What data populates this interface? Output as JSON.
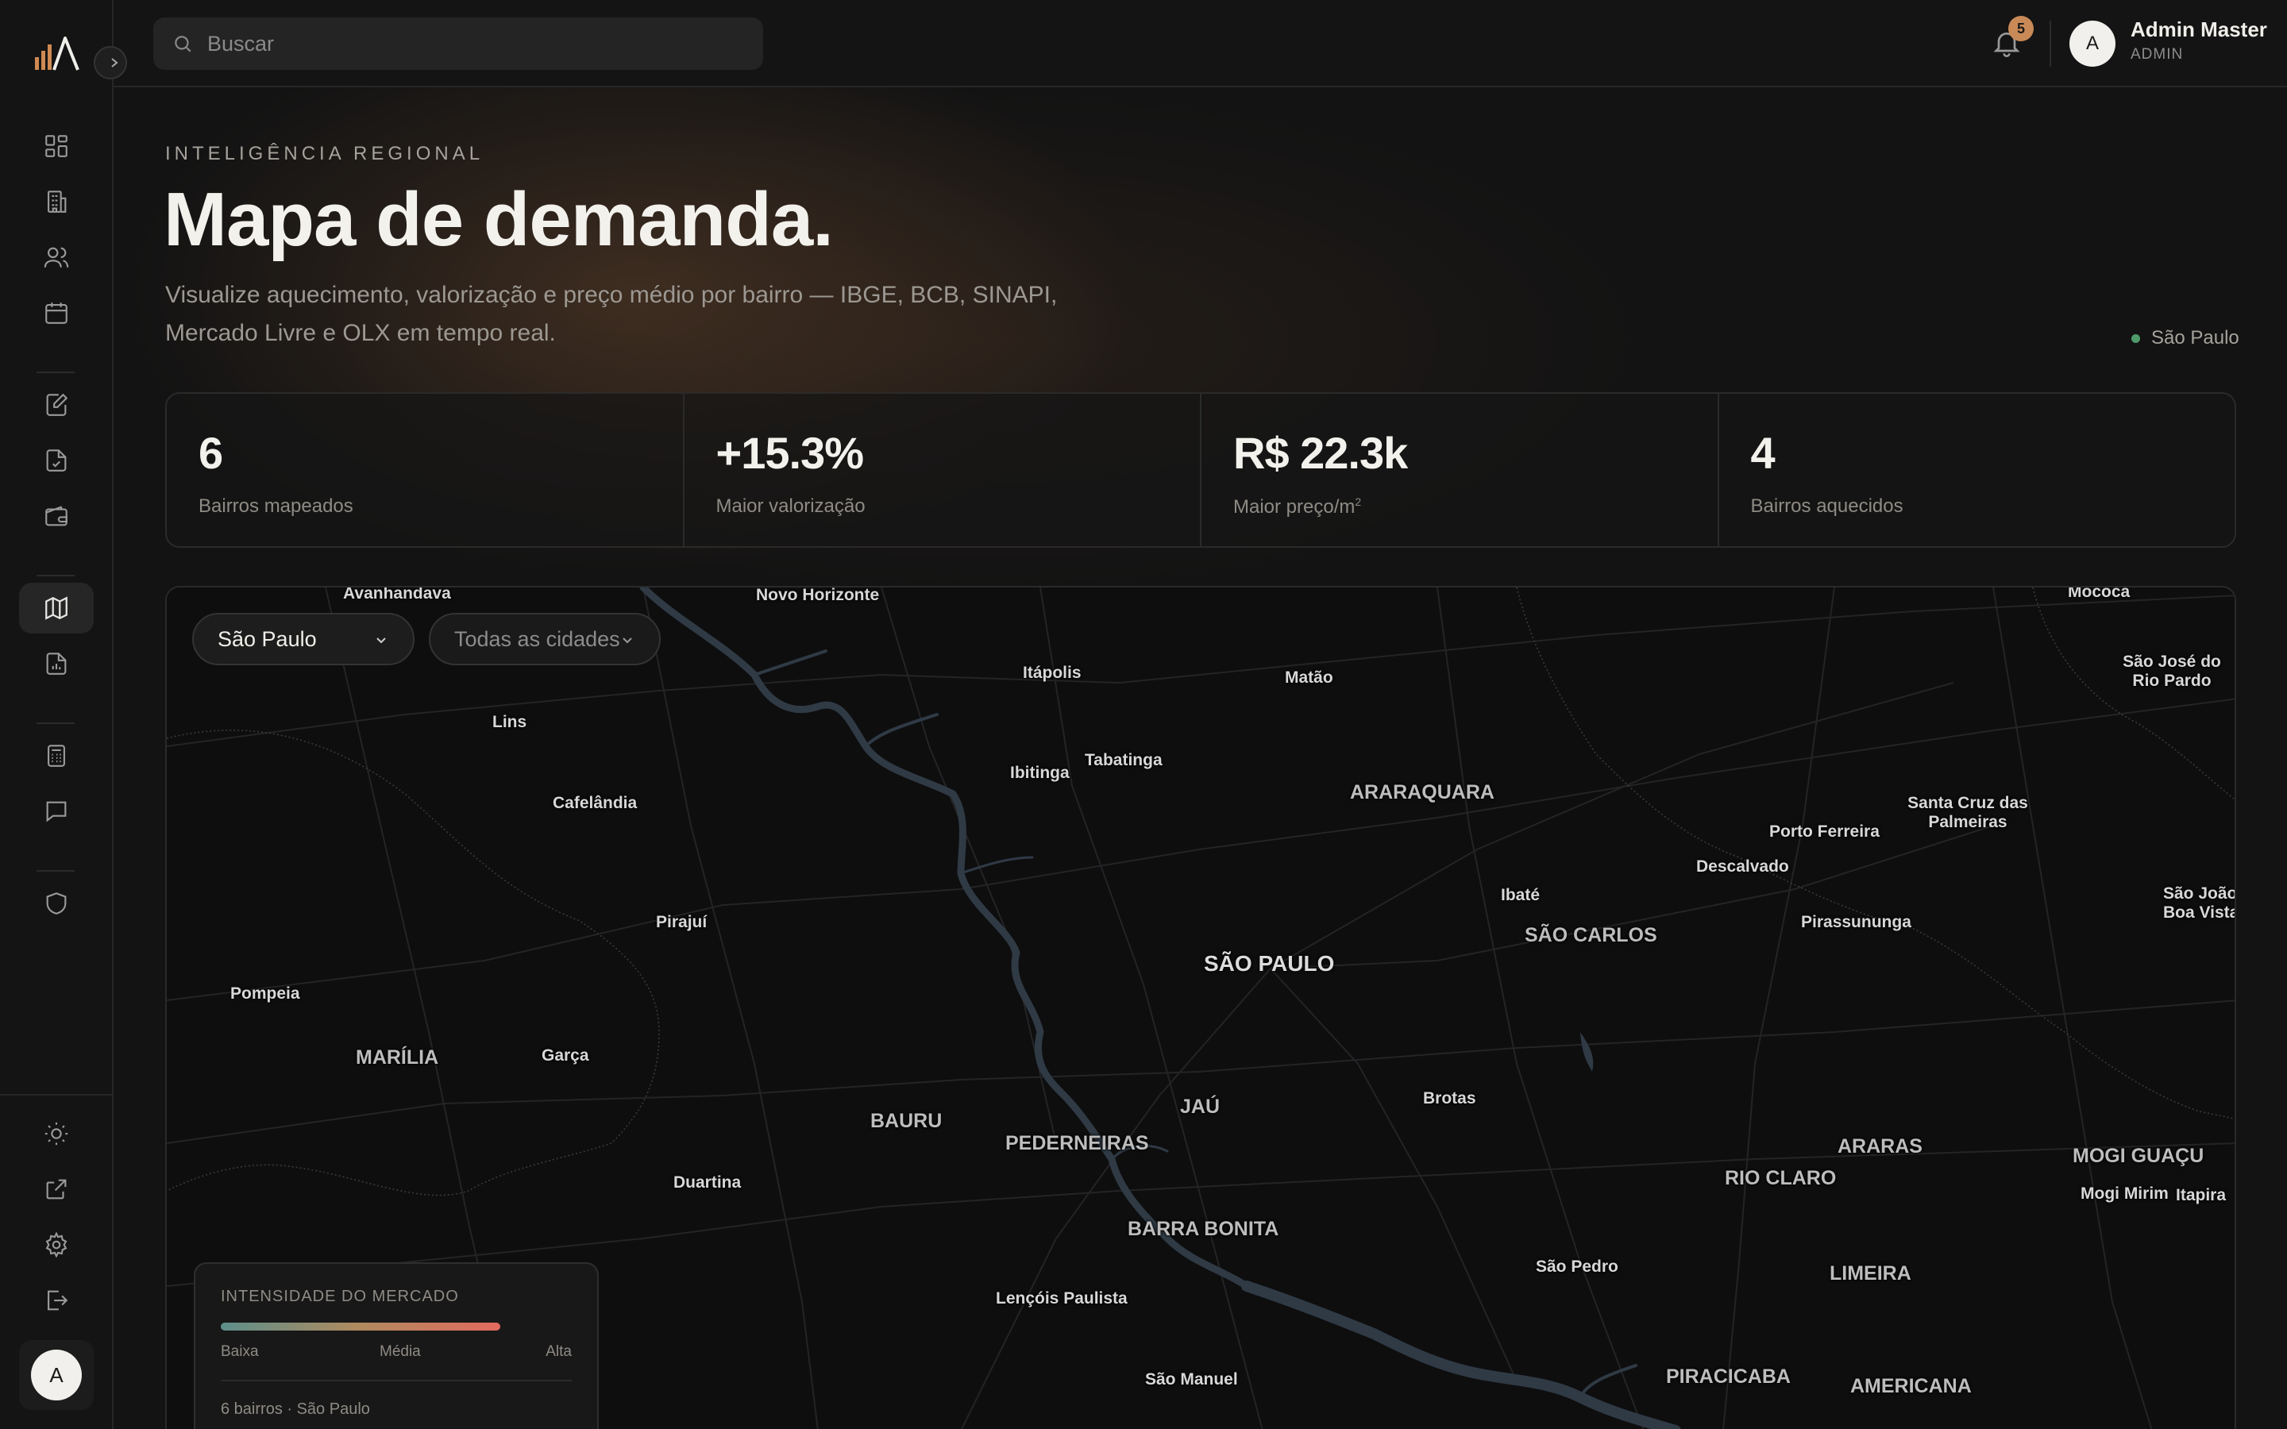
{
  "topbar": {
    "search_placeholder": "Buscar",
    "notifications_count": "5",
    "user": {
      "initial": "A",
      "name": "Admin Master",
      "role": "ADMIN"
    }
  },
  "sidebar": {
    "avatar_initial": "A",
    "items": [
      {
        "icon": "dashboard-icon"
      },
      {
        "icon": "building-icon"
      },
      {
        "icon": "users-icon"
      },
      {
        "icon": "calendar-icon"
      },
      {
        "icon": "edit-document-icon"
      },
      {
        "icon": "document-check-icon"
      },
      {
        "icon": "wallet-icon"
      },
      {
        "icon": "map-icon",
        "active": true
      },
      {
        "icon": "report-icon"
      },
      {
        "icon": "calculator-icon"
      },
      {
        "icon": "chat-icon"
      },
      {
        "icon": "shield-icon"
      },
      {
        "icon": "sun-icon"
      },
      {
        "icon": "external-link-icon"
      },
      {
        "icon": "settings-icon"
      },
      {
        "icon": "logout-icon"
      }
    ]
  },
  "hero": {
    "eyebrow": "INTELIGÊNCIA REGIONAL",
    "title": "Mapa de demanda.",
    "subtitle": "Visualize aquecimento, valorização e preço médio por bairro — IBGE, BCB, SINAPI, Mercado Livre e OLX em tempo real.",
    "region": "São Paulo",
    "region_dot_color": "#4f9a6b"
  },
  "stats": [
    {
      "value": "6",
      "label": "Bairros mapeados"
    },
    {
      "value": "+15.3%",
      "label": "Maior valorização"
    },
    {
      "value": "R$ 22.3k",
      "label": "Maior preço/m",
      "sup": "2"
    },
    {
      "value": "4",
      "label": "Bairros aquecidos"
    }
  ],
  "map": {
    "state_select": "São Paulo",
    "city_select": "Todas as cidades",
    "cities": [
      {
        "name": "Avanhandava",
        "kind": "small"
      },
      {
        "name": "Novo Horizonte",
        "kind": "small"
      },
      {
        "name": "Mococa",
        "kind": "small"
      },
      {
        "name": "São José do Rio Pardo",
        "kind": "small"
      },
      {
        "name": "Itápolis",
        "kind": "small"
      },
      {
        "name": "Matão",
        "kind": "small"
      },
      {
        "name": "Lins",
        "kind": "small"
      },
      {
        "name": "Tabatinga",
        "kind": "small"
      },
      {
        "name": "Ibitinga",
        "kind": "small"
      },
      {
        "name": "ARARAQUARA",
        "kind": "big"
      },
      {
        "name": "Cafelândia",
        "kind": "small"
      },
      {
        "name": "Santa Cruz das Palmeiras",
        "kind": "small"
      },
      {
        "name": "Porto Ferreira",
        "kind": "small"
      },
      {
        "name": "Descalvado",
        "kind": "small"
      },
      {
        "name": "Ibaté",
        "kind": "small"
      },
      {
        "name": "São João da Boa Vista",
        "kind": "small"
      },
      {
        "name": "Pirajuí",
        "kind": "small"
      },
      {
        "name": "Pirassununga",
        "kind": "small"
      },
      {
        "name": "SÃO CARLOS",
        "kind": "big"
      },
      {
        "name": "SÃO PAULO",
        "kind": "capital"
      },
      {
        "name": "Pompeia",
        "kind": "small"
      },
      {
        "name": "MARÍLIA",
        "kind": "big"
      },
      {
        "name": "Garça",
        "kind": "small"
      },
      {
        "name": "Brotas",
        "kind": "small"
      },
      {
        "name": "JAÚ",
        "kind": "big"
      },
      {
        "name": "BAURU",
        "kind": "big"
      },
      {
        "name": "PEDERNEIRAS",
        "kind": "big"
      },
      {
        "name": "ARARAS",
        "kind": "big"
      },
      {
        "name": "MOGI GUAÇU",
        "kind": "big"
      },
      {
        "name": "RIO CLARO",
        "kind": "big"
      },
      {
        "name": "Duartina",
        "kind": "small"
      },
      {
        "name": "Mogi Mirim",
        "kind": "small"
      },
      {
        "name": "Itapira",
        "kind": "small"
      },
      {
        "name": "BARRA BONITA",
        "kind": "big"
      },
      {
        "name": "São Pedro",
        "kind": "small"
      },
      {
        "name": "LIMEIRA",
        "kind": "big"
      },
      {
        "name": "Lençóis Paulista",
        "kind": "small"
      },
      {
        "name": "São Manuel",
        "kind": "small"
      },
      {
        "name": "PIRACICABA",
        "kind": "big"
      },
      {
        "name": "AMERICANA",
        "kind": "big"
      }
    ],
    "legend": {
      "title": "INTENSIDADE DO MERCADO",
      "low": "Baixa",
      "mid": "Média",
      "high": "Alta",
      "count": "6 bairros · São Paulo",
      "gradient": [
        "#5d8f8a",
        "#b08a5e",
        "#e26a5e"
      ]
    }
  }
}
